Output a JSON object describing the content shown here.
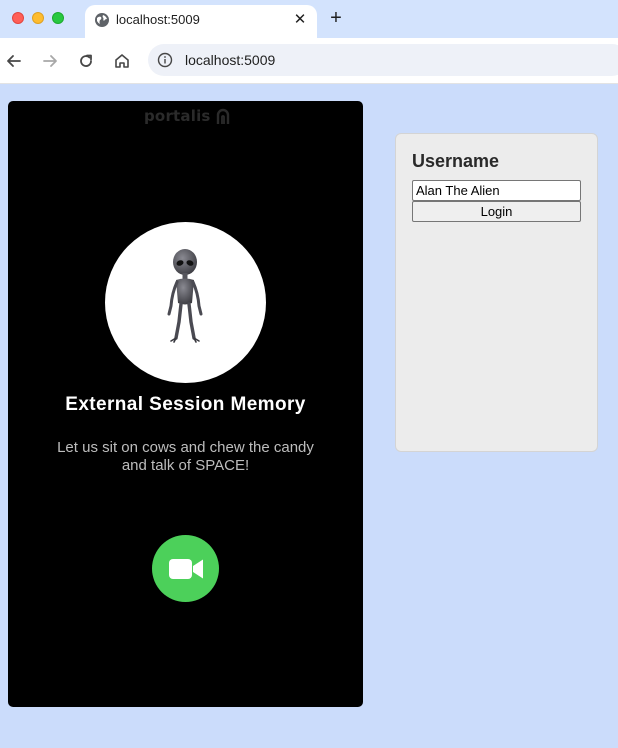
{
  "browser": {
    "tab_title": "localhost:5009",
    "new_tab_symbol": "+",
    "close_symbol": "✕",
    "url": "localhost:5009"
  },
  "icons": {
    "tab": "globe-icon",
    "back": "back-arrow-icon",
    "forward": "forward-arrow-icon",
    "reload": "reload-icon",
    "home": "home-icon",
    "site_info": "info-icon",
    "avatar": "alien-figure",
    "call": "video-camera-icon"
  },
  "card": {
    "brand": "portalis",
    "title": "External Session Memory",
    "subtitle": "Let us sit on cows and chew the candy and talk of SPACE!"
  },
  "login": {
    "heading": "Username",
    "username_value": "Alan The Alien",
    "button_label": "Login"
  },
  "colors": {
    "page_background": "#cbdcfb",
    "card_background": "#000000",
    "call_button": "#4cd05a",
    "panel_background": "#ececec"
  }
}
